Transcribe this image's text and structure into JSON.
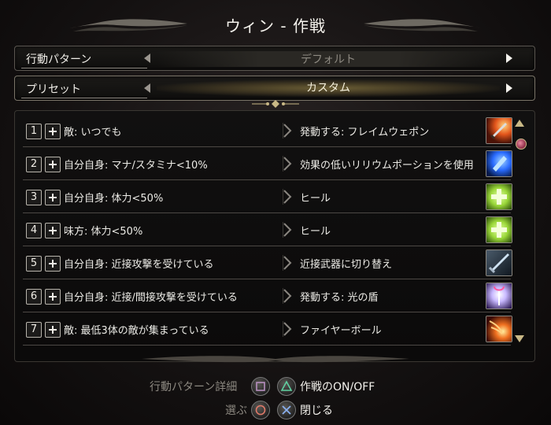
{
  "title": "ウィン - 作戦",
  "behavior": {
    "label": "行動パターン",
    "value": "デフォルト"
  },
  "preset": {
    "label": "プリセット",
    "value": "カスタム"
  },
  "tactics": [
    {
      "num": "1",
      "condition": "敵: いつでも",
      "action": "発動する: フレイムウェポン",
      "icon": "flame-weapon-icon"
    },
    {
      "num": "2",
      "condition": "自分自身: マナ/スタミナ<10%",
      "action": "効果の低いリリウムポーションを使用",
      "icon": "lyrium-potion-icon"
    },
    {
      "num": "3",
      "condition": "自分自身: 体力<50%",
      "action": "ヒール",
      "icon": "heal-icon"
    },
    {
      "num": "4",
      "condition": "味方: 体力<50%",
      "action": "ヒール",
      "icon": "heal-icon"
    },
    {
      "num": "5",
      "condition": "自分自身: 近接攻撃を受けている",
      "action": "近接武器に切り替え",
      "icon": "melee-weapon-icon"
    },
    {
      "num": "6",
      "condition": "自分自身: 近接/間接攻撃を受けている",
      "action": "発動する: 光の盾",
      "icon": "light-shield-icon"
    },
    {
      "num": "7",
      "condition": "敵: 最低3体の敵が集まっている",
      "action": "ファイヤーボール",
      "icon": "fireball-icon"
    }
  ],
  "help": {
    "details": "行動パターン詳細",
    "toggle": "作戦のON/OFF",
    "select": "選ぶ",
    "close": "閉じる"
  },
  "colors": {
    "accent_gold": "#c9b886",
    "heal_green": "#9bd83a",
    "fire_orange": "#e4561c",
    "potion_blue": "#2a6cff"
  }
}
